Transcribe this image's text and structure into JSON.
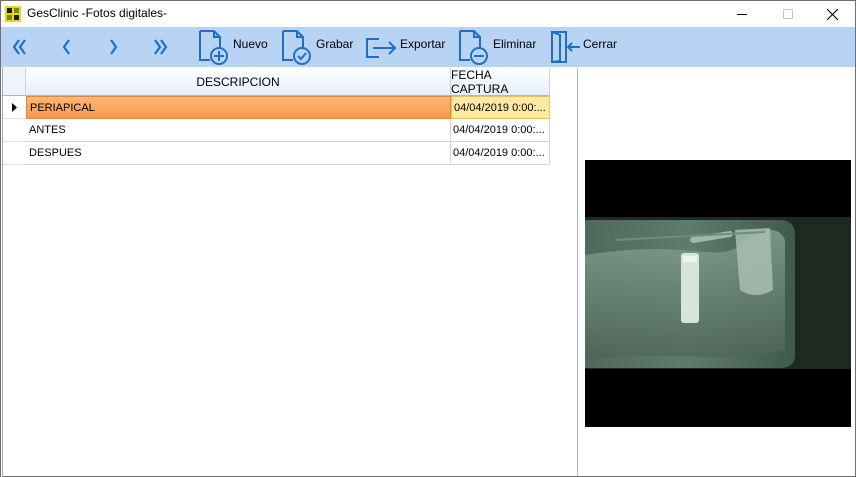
{
  "window": {
    "title": "GesClinic -Fotos digitales-",
    "icon": "app-logo-icon",
    "controls": [
      "minimize-icon",
      "maximize-icon",
      "close-icon"
    ]
  },
  "toolbar": {
    "nav": [
      {
        "name": "first-record",
        "glyph": "《"
      },
      {
        "name": "previous-record",
        "glyph": "❬"
      },
      {
        "name": "next-record",
        "glyph": "❭"
      },
      {
        "name": "last-record",
        "glyph": "》"
      }
    ],
    "nuevo_label": "Nuevo",
    "grabar_label": "Grabar",
    "exportar_label": "Exportar",
    "eliminar_label": "Eliminar",
    "cerrar_label": "Cerrar",
    "accent_color": "#1f6fc9",
    "background_color": "#b9d3f5"
  },
  "grid": {
    "columns": [
      "DESCRIPCION",
      "FECHA CAPTURA"
    ],
    "rows": [
      {
        "descripcion": "PERIAPICAL",
        "fecha": "04/04/2019  0:00:...",
        "selected": true
      },
      {
        "descripcion": "ANTES",
        "fecha": "04/04/2019  0:00:..."
      },
      {
        "descripcion": "DESPUES",
        "fecha": "04/04/2019  0:00:..."
      }
    ],
    "selected_row_color": "#f79a4a"
  },
  "preview": {
    "image": "dental-xray-image"
  }
}
